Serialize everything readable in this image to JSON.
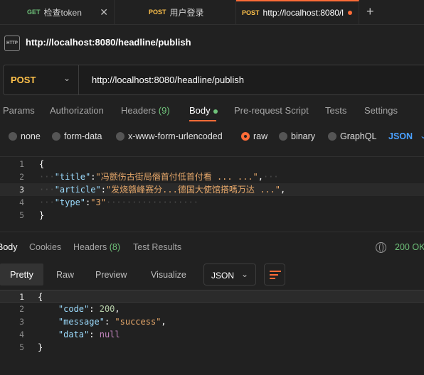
{
  "tabs": [
    {
      "method": "GET",
      "method_color": "#6fc37a",
      "label": "检查token",
      "active": false
    },
    {
      "method": "POST",
      "method_color": "#ffc24b",
      "label": "用户登录",
      "active": false
    },
    {
      "method": "POST",
      "method_color": "#ffc24b",
      "label": "http://localhost:8080/l",
      "active": true
    }
  ],
  "tab_add_icon": "plus-icon",
  "request": {
    "title": "http://localhost:8080/headline/publish",
    "icon_text": "HTTP",
    "method": "POST",
    "url": "http://localhost:8080/headline/publish"
  },
  "request_tabs": {
    "params": "Params",
    "authorization": "Authorization",
    "headers": "Headers",
    "headers_count": "(9)",
    "body": "Body",
    "pre_request": "Pre-request Script",
    "tests": "Tests",
    "settings": "Settings"
  },
  "body_types": {
    "none": "none",
    "form_data": "form-data",
    "urlencoded": "x-www-form-urlencoded",
    "raw": "raw",
    "binary": "binary",
    "graphql": "GraphQL",
    "format": "JSON"
  },
  "request_body": {
    "line_numbers": [
      "1",
      "2",
      "3",
      "4",
      "5"
    ],
    "open": "{",
    "title_key": "\"title\"",
    "title_value": "\"冯颤伤古街局僭首付低首付看 ... ...\"",
    "article_key": "\"article\"",
    "article_value": "\"发烧赣峰赛分...德国大使馆搭嗎万达 ...\"",
    "type_key": "\"type\"",
    "type_value": "\"3\"",
    "close": "}"
  },
  "response_tabs": {
    "body": "Body",
    "cookies": "Cookies",
    "headers": "Headers",
    "headers_count": "(8)",
    "test_results": "Test Results"
  },
  "response_status": "200 OK",
  "response_view": {
    "pretty": "Pretty",
    "raw": "Raw",
    "preview": "Preview",
    "visualize": "Visualize",
    "format": "JSON"
  },
  "response_body": {
    "line_numbers": [
      "1",
      "2",
      "3",
      "4",
      "5"
    ],
    "open": "{",
    "code_key": "\"code\"",
    "code_value": "200",
    "message_key": "\"message\"",
    "message_value": "\"success\"",
    "data_key": "\"data\"",
    "data_value": "null",
    "close": "}"
  },
  "colors": {
    "accent": "#ff6c37",
    "get_method": "#6fc37a",
    "post_method": "#ffc24b",
    "status_ok": "#6fc37a",
    "json_link": "#4aa0ff"
  }
}
